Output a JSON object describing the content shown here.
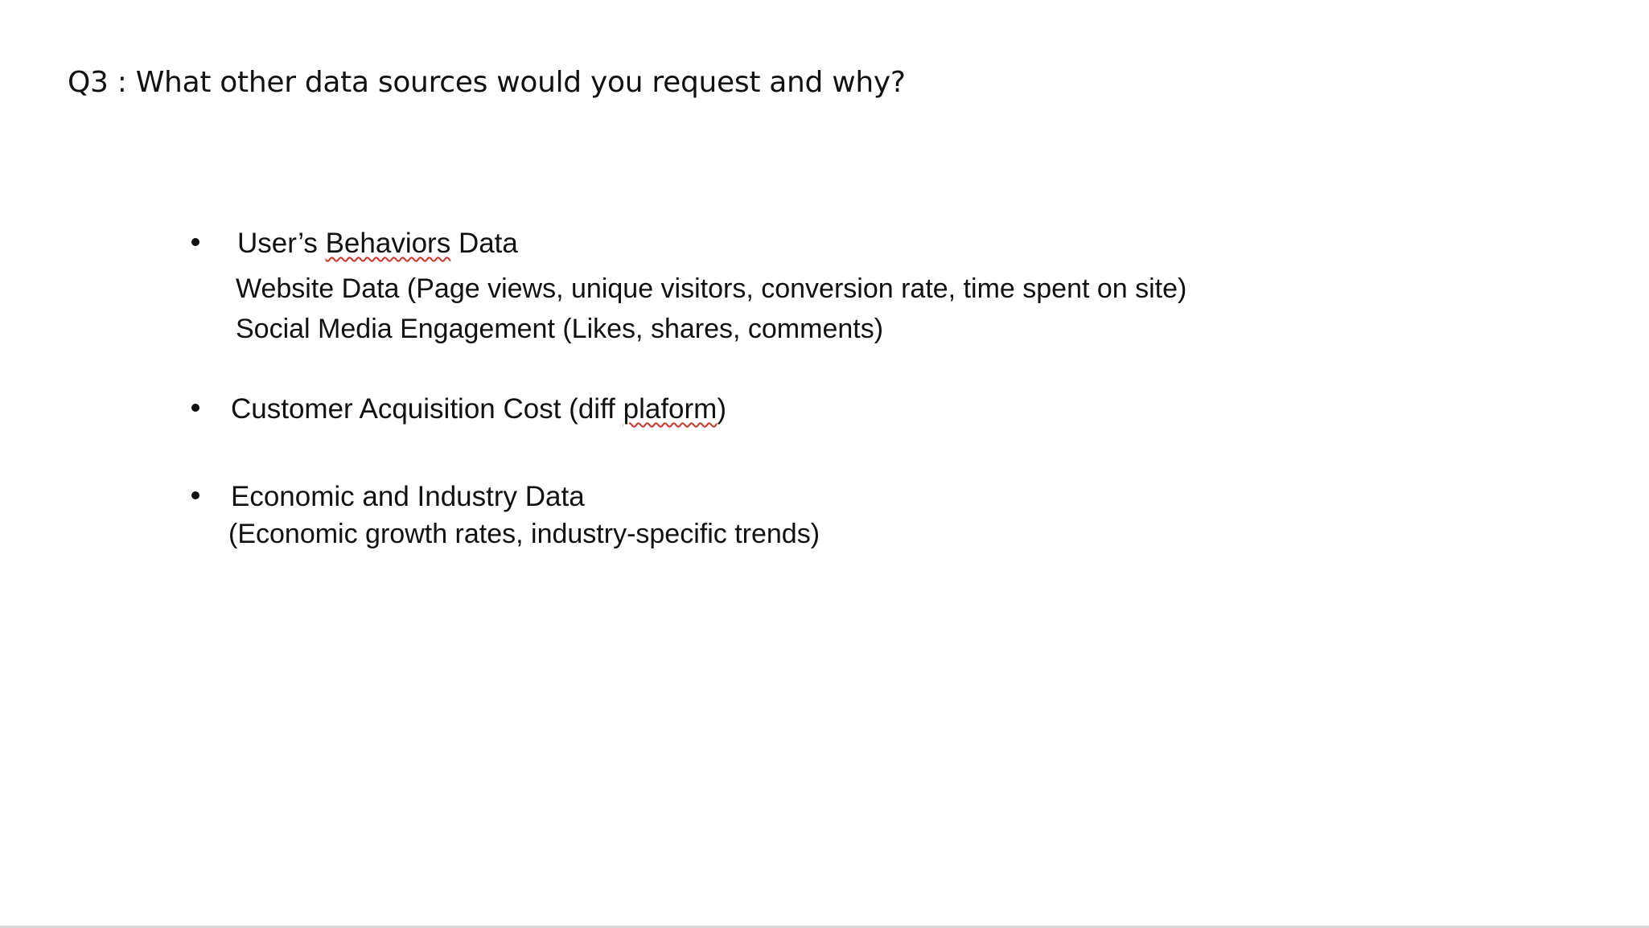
{
  "slide": {
    "title": "Q3 : What other data sources would you request and why?",
    "bullets": [
      {
        "heading_prefix": "User’s ",
        "heading_flagged_word": "Behaviors",
        "heading_suffix": " Data",
        "details": [
          "Website Data (Page views, unique visitors, conversion rate, time spent on site)",
          "Social Media Engagement (Likes, shares, comments)"
        ]
      },
      {
        "heading_prefix": "Customer Acquisition Cost (diff ",
        "heading_flagged_word": "plaform",
        "heading_suffix": ")"
      },
      {
        "heading": "Economic and Industry Data",
        "details": [
          "(Economic growth rates, industry-specific trends)"
        ]
      }
    ],
    "colors": {
      "text": "#111111",
      "background": "#ffffff",
      "spellcheck_underline": "#d93025"
    }
  }
}
